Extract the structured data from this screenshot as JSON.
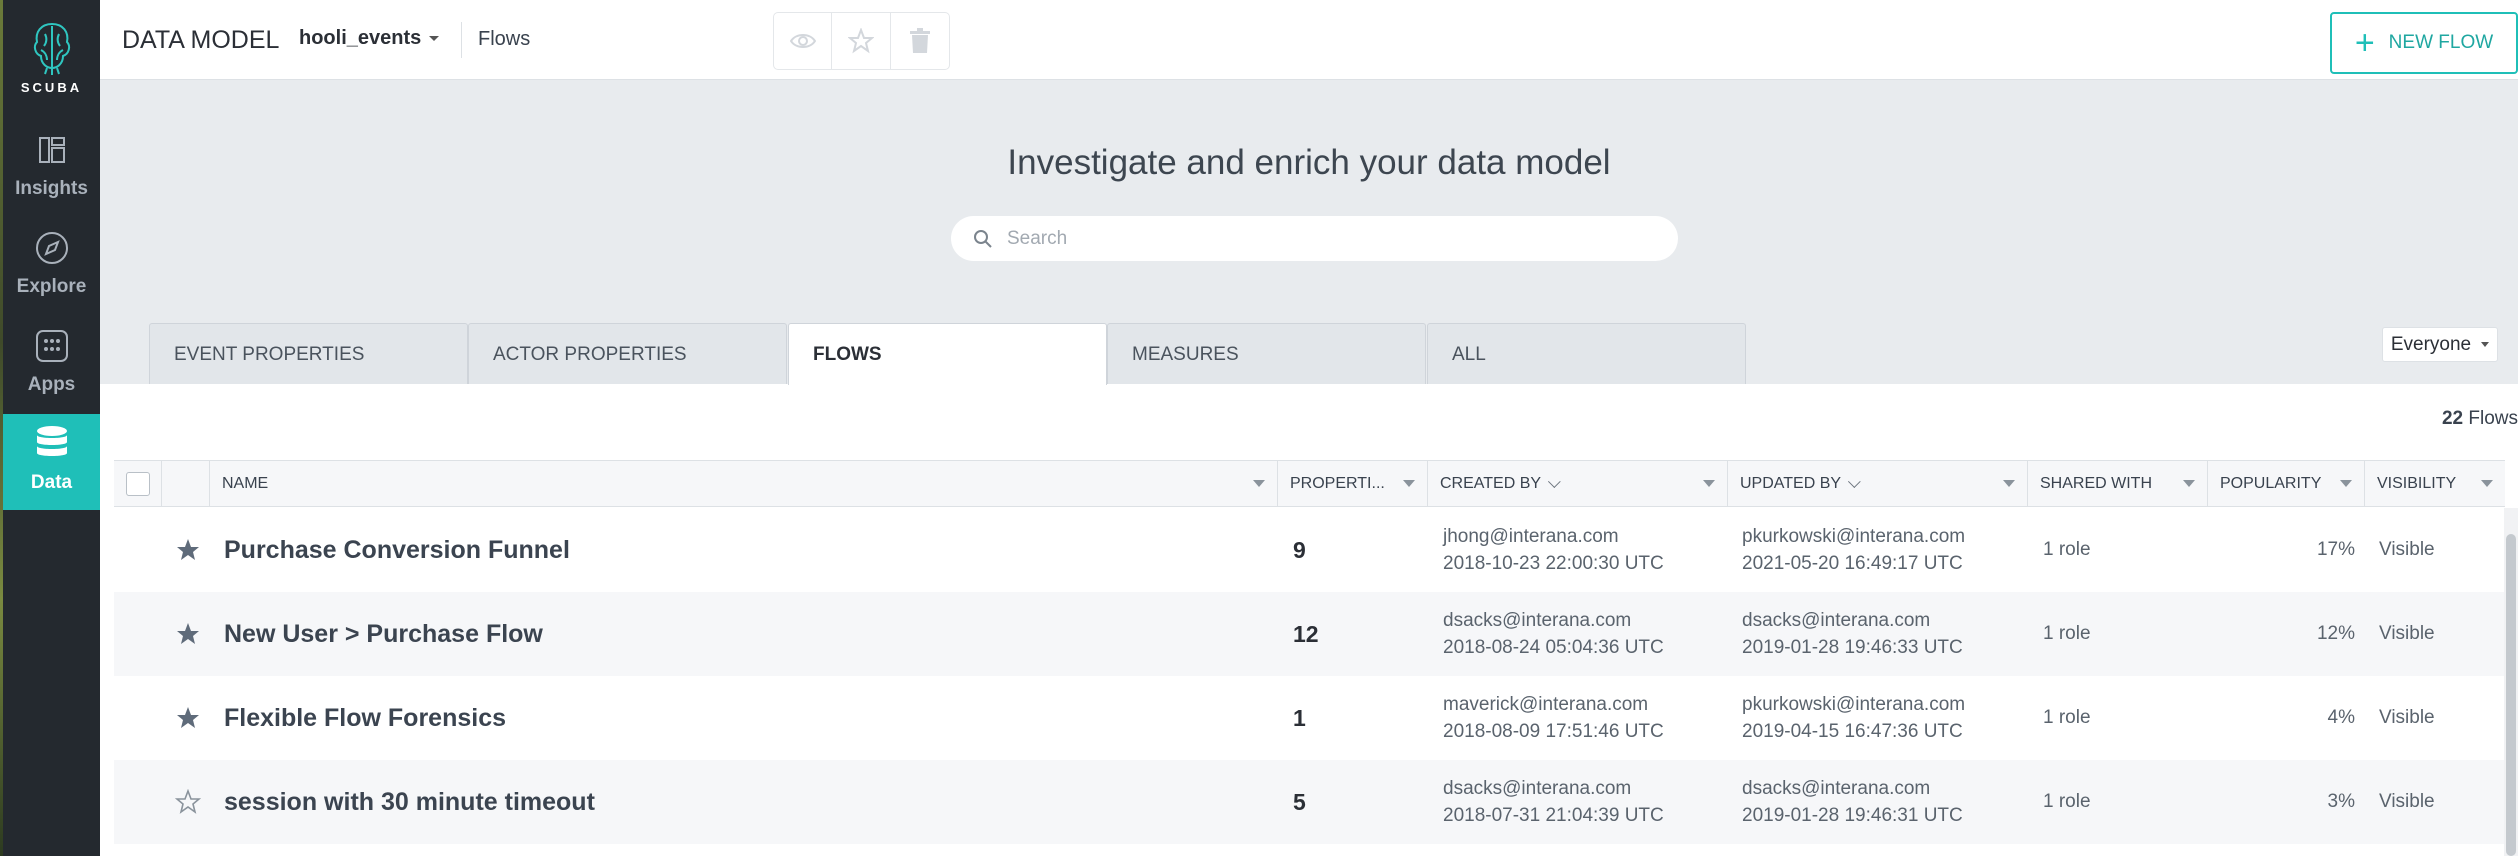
{
  "sidebar": {
    "logo_text": "SCUBA",
    "items": [
      {
        "label": "Insights",
        "icon": "insights-icon",
        "active": false
      },
      {
        "label": "Explore",
        "icon": "compass-icon",
        "active": false
      },
      {
        "label": "Apps",
        "icon": "apps-grid-icon",
        "active": false
      },
      {
        "label": "Data",
        "icon": "database-icon",
        "active": true
      }
    ]
  },
  "header": {
    "title": "DATA MODEL",
    "dataset": "hooli_events",
    "breadcrumb": "Flows",
    "tools": [
      "eye-icon",
      "star-icon",
      "trash-icon"
    ],
    "new_button": "NEW FLOW"
  },
  "hero": {
    "title": "Investigate and enrich your data model",
    "search_placeholder": "Search",
    "search_value": ""
  },
  "tabs": [
    {
      "label": "EVENT PROPERTIES",
      "active": false
    },
    {
      "label": "ACTOR PROPERTIES",
      "active": false
    },
    {
      "label": "FLOWS",
      "active": true
    },
    {
      "label": "MEASURES",
      "active": false
    },
    {
      "label": "ALL",
      "active": false
    }
  ],
  "audience_filter": "Everyone",
  "count": {
    "number": "22",
    "label": "Flows"
  },
  "columns": {
    "name": "NAME",
    "properties": "PROPERTI...",
    "created_by": "CREATED BY",
    "updated_by": "UPDATED BY",
    "shared_with": "SHARED WITH",
    "popularity": "POPULARITY",
    "visibility": "VISIBILITY"
  },
  "rows": [
    {
      "starred": true,
      "name": "Purchase Conversion Funnel",
      "properties": "9",
      "created_by": "jhong@interana.com",
      "created_at": "2018-10-23 22:00:30 UTC",
      "updated_by": "pkurkowski@interana.com",
      "updated_at": "2021-05-20 16:49:17 UTC",
      "shared_with": "1 role",
      "popularity": "17%",
      "visibility": "Visible"
    },
    {
      "starred": true,
      "name": "New User > Purchase Flow",
      "properties": "12",
      "created_by": "dsacks@interana.com",
      "created_at": "2018-08-24 05:04:36 UTC",
      "updated_by": "dsacks@interana.com",
      "updated_at": "2019-01-28 19:46:33 UTC",
      "shared_with": "1 role",
      "popularity": "12%",
      "visibility": "Visible"
    },
    {
      "starred": true,
      "name": "Flexible Flow Forensics",
      "properties": "1",
      "created_by": "maverick@interana.com",
      "created_at": "2018-08-09 17:51:46 UTC",
      "updated_by": "pkurkowski@interana.com",
      "updated_at": "2019-04-15 16:47:36 UTC",
      "shared_with": "1 role",
      "popularity": "4%",
      "visibility": "Visible"
    },
    {
      "starred": false,
      "name": "session with 30 minute timeout",
      "properties": "5",
      "created_by": "dsacks@interana.com",
      "created_at": "2018-07-31 21:04:39 UTC",
      "updated_by": "dsacks@interana.com",
      "updated_at": "2019-01-28 19:46:31 UTC",
      "shared_with": "1 role",
      "popularity": "3%",
      "visibility": "Visible"
    }
  ],
  "colors": {
    "accent": "#1fbfb8",
    "sidebar": "#24292f",
    "star": "#5f6b7a"
  }
}
